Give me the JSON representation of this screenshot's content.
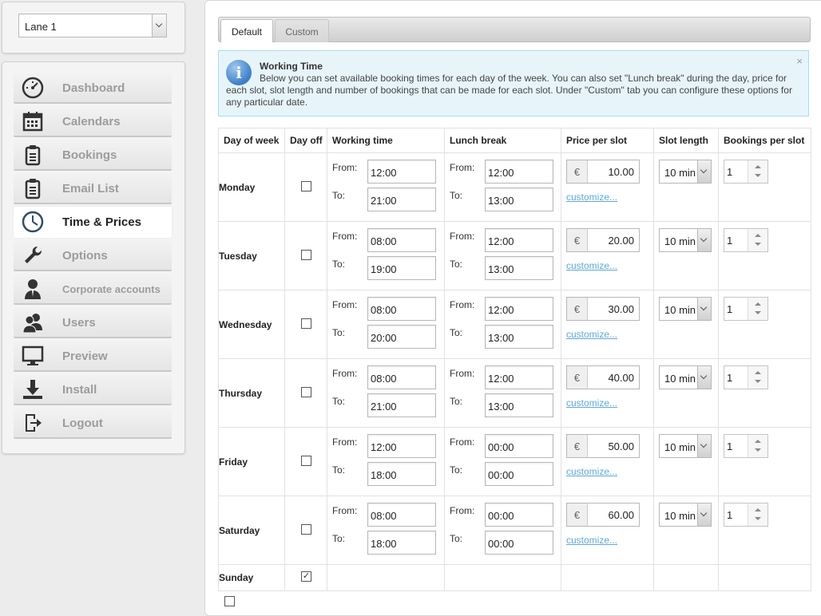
{
  "lane_select": {
    "value": "Lane 1"
  },
  "nav": [
    {
      "label": "Dashboard",
      "icon": "dashboard-icon"
    },
    {
      "label": "Calendars",
      "icon": "calendar-icon"
    },
    {
      "label": "Bookings",
      "icon": "clipboard-icon"
    },
    {
      "label": "Email List",
      "icon": "clipboard-icon"
    },
    {
      "label": "Time & Prices",
      "icon": "clock-icon",
      "active": true
    },
    {
      "label": "Options",
      "icon": "wrench-icon"
    },
    {
      "label": "Corporate accounts",
      "icon": "business-person-icon"
    },
    {
      "label": "Users",
      "icon": "users-icon"
    },
    {
      "label": "Preview",
      "icon": "monitor-icon"
    },
    {
      "label": "Install",
      "icon": "download-icon"
    },
    {
      "label": "Logout",
      "icon": "logout-icon"
    }
  ],
  "tabs": [
    {
      "label": "Default",
      "active": true
    },
    {
      "label": "Custom",
      "active": false
    }
  ],
  "info": {
    "title": "Working Time",
    "text": "Below you can set available booking times for each day of the week. You can also set \"Lunch break\" during the day, price for each slot, slot length and number of bookings that can be made for each slot. Under \"Custom\" tab you can configure these options for any particular date.",
    "close": "×"
  },
  "table": {
    "headers": {
      "day": "Day of week",
      "dayoff": "Day off",
      "working": "Working time",
      "lunch": "Lunch break",
      "price": "Price per slot",
      "slot": "Slot length",
      "bookings": "Bookings per slot"
    },
    "from_label": "From:",
    "to_label": "To:",
    "currency": "€",
    "customize": "customize...",
    "rows": [
      {
        "day": "Monday",
        "off": false,
        "work_from": "12:00",
        "work_to": "21:00",
        "lunch_from": "12:00",
        "lunch_to": "13:00",
        "price": "10.00",
        "slot": "10 min",
        "bookings": "1"
      },
      {
        "day": "Tuesday",
        "off": false,
        "work_from": "08:00",
        "work_to": "19:00",
        "lunch_from": "12:00",
        "lunch_to": "13:00",
        "price": "20.00",
        "slot": "10 min",
        "bookings": "1"
      },
      {
        "day": "Wednesday",
        "off": false,
        "work_from": "08:00",
        "work_to": "20:00",
        "lunch_from": "12:00",
        "lunch_to": "13:00",
        "price": "30.00",
        "slot": "10 min",
        "bookings": "1"
      },
      {
        "day": "Thursday",
        "off": false,
        "work_from": "08:00",
        "work_to": "21:00",
        "lunch_from": "12:00",
        "lunch_to": "13:00",
        "price": "40.00",
        "slot": "10 min",
        "bookings": "1"
      },
      {
        "day": "Friday",
        "off": false,
        "work_from": "12:00",
        "work_to": "18:00",
        "lunch_from": "00:00",
        "lunch_to": "00:00",
        "price": "50.00",
        "slot": "10 min",
        "bookings": "1"
      },
      {
        "day": "Saturday",
        "off": false,
        "work_from": "08:00",
        "work_to": "18:00",
        "lunch_from": "00:00",
        "lunch_to": "00:00",
        "price": "60.00",
        "slot": "10 min",
        "bookings": "1"
      }
    ],
    "sunday": {
      "day": "Sunday",
      "off": true,
      "check": "✓"
    }
  }
}
